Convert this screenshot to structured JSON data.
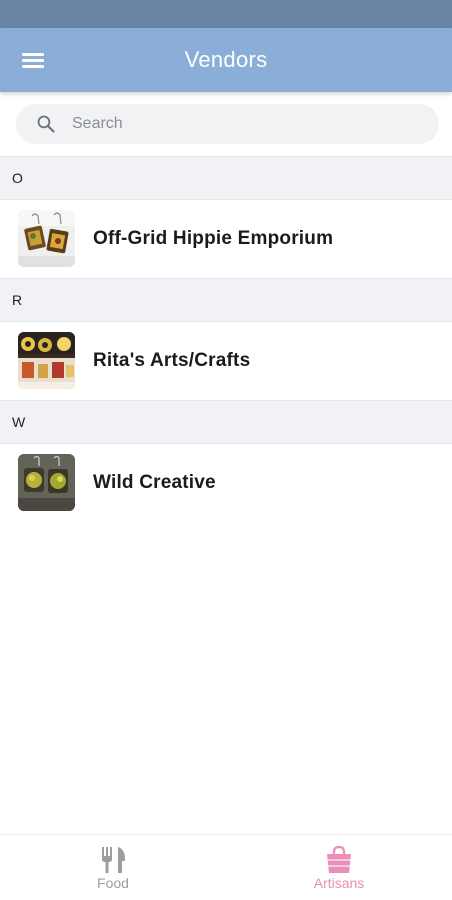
{
  "app_bar": {
    "title": "Vendors",
    "background": "#8aaed8"
  },
  "search": {
    "placeholder": "Search",
    "value": ""
  },
  "sections": [
    {
      "letter": "O",
      "vendors": [
        {
          "name": "Off-Grid Hippie Emporium",
          "thumbnail": "earrings-photo"
        }
      ]
    },
    {
      "letter": "R",
      "vendors": [
        {
          "name": "Rita's Arts/Crafts",
          "thumbnail": "crafts-photo"
        }
      ]
    },
    {
      "letter": "W",
      "vendors": [
        {
          "name": "Wild Creative",
          "thumbnail": "earrings-photo"
        }
      ]
    }
  ],
  "bottom_nav": {
    "tabs": [
      {
        "label": "Food",
        "icon": "fork-knife-icon",
        "active": false,
        "color": "#9e9e9e"
      },
      {
        "label": "Artisans",
        "icon": "shopping-bag-icon",
        "active": true,
        "color": "#e98fb8"
      }
    ]
  }
}
